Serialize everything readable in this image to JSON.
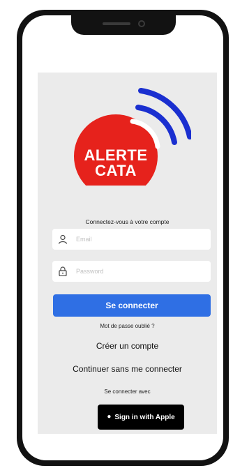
{
  "logo": {
    "line1": "ALERTE",
    "line2": "CATA",
    "circle_color": "#e6221c",
    "arc_color": "#1a2fd0"
  },
  "login": {
    "title": "Connectez-vous à votre compte",
    "email_placeholder": "Email",
    "password_placeholder": "Password",
    "submit_label": "Se connecter",
    "forgot_label": "Mot de passe oublié ?",
    "create_label": "Créer un compte",
    "continue_label": "Continuer sans me connecter",
    "connect_with_label": "Se connecter avec",
    "apple_label": "Sign in with Apple"
  },
  "icons": {
    "email": "user-icon",
    "password": "lock-icon",
    "apple": "apple-icon"
  },
  "colors": {
    "primary": "#2f6fe4",
    "background": "#ebebeb",
    "field": "#ffffff",
    "apple_button": "#000000"
  }
}
